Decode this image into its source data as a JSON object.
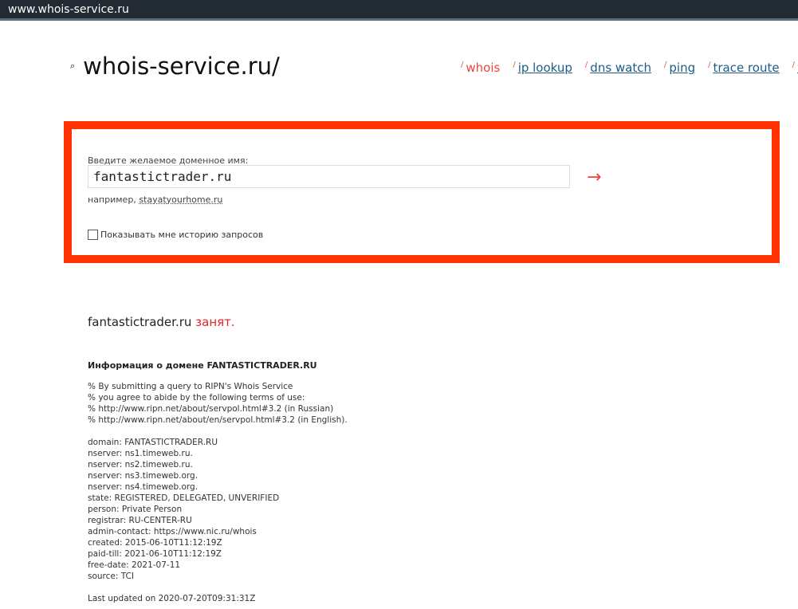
{
  "browser": {
    "url": "www.whois-service.ru"
  },
  "header": {
    "logo": "whois-service.ru/",
    "nav": [
      {
        "label": "whois",
        "active": true
      },
      {
        "label": "ip lookup"
      },
      {
        "label": "dns watch"
      },
      {
        "label": "ping"
      },
      {
        "label": "trace route"
      },
      {
        "label": "wha"
      }
    ]
  },
  "search": {
    "label": "Введите желаемое доменное имя:",
    "value": "fantastictrader.ru",
    "example_prefix": "например,",
    "example": "stayatyourhome.ru",
    "history_label": "Показывать мне историю запросов",
    "submit": "→"
  },
  "result": {
    "domain": "fantastictrader.ru",
    "status": "занят."
  },
  "whois": {
    "title": "Информация о домене FANTASTICTRADER.RU",
    "terms": [
      "% By submitting a query to RIPN's Whois Service",
      "% you agree to abide by the following terms of use:",
      "% http://www.ripn.net/about/servpol.html#3.2 (in Russian)",
      "% http://www.ripn.net/about/en/servpol.html#3.2 (in English)."
    ],
    "records": [
      "domain: FANTASTICTRADER.RU",
      "nserver: ns1.timeweb.ru.",
      "nserver: ns2.timeweb.ru.",
      "nserver: ns3.timeweb.org.",
      "nserver: ns4.timeweb.org.",
      "state: REGISTERED, DELEGATED, UNVERIFIED",
      "person: Private Person",
      "registrar: RU-CENTER-RU",
      "admin-contact: https://www.nic.ru/whois",
      "created: 2015-06-10T11:12:19Z",
      "paid-till: 2021-06-10T11:12:19Z",
      "free-date: 2021-07-11",
      "source: TCI"
    ],
    "updated": "Last updated on 2020-07-20T09:31:31Z"
  }
}
